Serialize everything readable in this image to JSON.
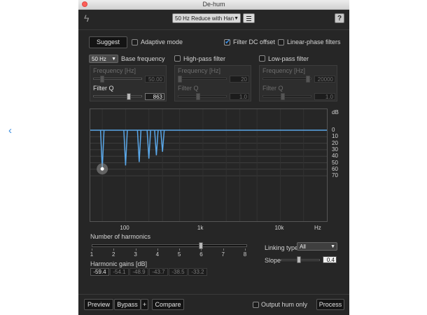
{
  "window": {
    "title": "De-hum"
  },
  "toolbar": {
    "preset_value": "50 Hz Reduce with Han",
    "menu_icon": "menu-icon",
    "help_label": "?"
  },
  "controls": {
    "suggest_label": "Suggest",
    "adaptive_mode_label": "Adaptive mode",
    "adaptive_mode_checked": false,
    "filter_dc_offset_label": "Filter DC offset",
    "filter_dc_offset_checked": true,
    "linear_phase_label": "Linear-phase filters",
    "linear_phase_checked": false
  },
  "base": {
    "frequency_value": "50 Hz",
    "frequency_label": "Base frequency",
    "frequency_hz_label": "Frequency [Hz]",
    "frequency_hz_value": "50.00",
    "filter_q_label": "Filter Q",
    "filter_q_value": "863"
  },
  "highpass": {
    "label": "High-pass filter",
    "checked": false,
    "frequency_label": "Frequency [Hz]",
    "frequency_value": "20",
    "q_label": "Filter Q",
    "q_value": "1.0"
  },
  "lowpass": {
    "label": "Low-pass filter",
    "checked": false,
    "frequency_label": "Frequency [Hz]",
    "frequency_value": "20000",
    "q_label": "Filter Q",
    "q_value": "1.0"
  },
  "graph": {
    "unit_label": "dB",
    "db_ticks": [
      "0",
      "10",
      "20",
      "30",
      "40",
      "50",
      "60",
      "70"
    ],
    "x_ticks": [
      "100",
      "1k",
      "10k",
      "Hz"
    ]
  },
  "chart_data": {
    "type": "line",
    "x_scale": "log",
    "xlabel": "Hz",
    "ylabel": "dB",
    "ylim": [
      0,
      80
    ],
    "notches": [
      {
        "frequency_hz": 50,
        "depth_db": 59.4
      },
      {
        "frequency_hz": 100,
        "depth_db": 54.1
      },
      {
        "frequency_hz": 150,
        "depth_db": 48.9
      },
      {
        "frequency_hz": 200,
        "depth_db": 43.7
      },
      {
        "frequency_hz": 250,
        "depth_db": 38.5
      },
      {
        "frequency_hz": 300,
        "depth_db": 33.2
      }
    ]
  },
  "harmonics": {
    "label": "Number of harmonics",
    "ticks": [
      "1",
      "2",
      "3",
      "4",
      "5",
      "6",
      "7",
      "8"
    ],
    "value": 6,
    "gains_label": "Harmonic gains [dB]",
    "gains": [
      "-59.4",
      "-54.1",
      "-48.9",
      "-43.7",
      "-38.5",
      "-33.2"
    ]
  },
  "linking": {
    "type_label": "Linking type",
    "type_value": "All",
    "slope_label": "Slope",
    "slope_value": "0.4"
  },
  "bottom": {
    "preview_label": "Preview",
    "bypass_label": "Bypass",
    "plus_label": "+",
    "compare_label": "Compare",
    "output_hum_label": "Output hum only",
    "output_hum_checked": false,
    "process_label": "Process"
  },
  "colors": {
    "accent": "#3b8de0",
    "curve": "#5aa7e8",
    "panel": "#262626"
  }
}
